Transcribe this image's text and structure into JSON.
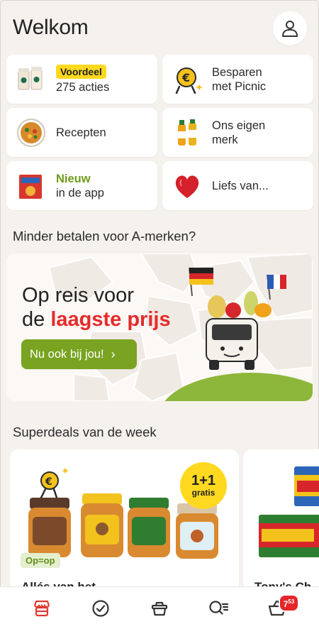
{
  "header": {
    "title": "Welkom"
  },
  "tiles": [
    {
      "badge": "Voordeel",
      "label": "275 acties"
    },
    {
      "label": "Besparen met Picnic"
    },
    {
      "label": "Recepten"
    },
    {
      "label": "Ons eigen merk"
    },
    {
      "accent": "Nieuw",
      "label": "in de app"
    },
    {
      "label": "Liefs van..."
    }
  ],
  "sections": {
    "brands_title": "Minder betalen voor A-merken?",
    "deals_title": "Superdeals van de week"
  },
  "banner": {
    "line1": "Op reis voor",
    "line2_prefix": "de",
    "line2_highlight": "laagste prijs",
    "cta": "Nu ook bij jou!",
    "cta_chevron": "›"
  },
  "deals": {
    "card1": {
      "promo_big": "1+1",
      "promo_small": "gratis",
      "label": "Op=op",
      "name": "Allés van het..."
    },
    "card2": {
      "name": "Tony's Ch..."
    }
  },
  "cart": {
    "badge_main": "7",
    "badge_sup": "53"
  },
  "colors": {
    "accent_green": "#79a321",
    "accent_red": "#e62a2a",
    "badge_yellow": "#ffd91f",
    "background": "#f5f2ee"
  },
  "icons": {
    "profile": "person-icon",
    "nav": [
      "store-icon",
      "checkmark-icon",
      "basket-icon",
      "search-list-icon",
      "cart-icon"
    ]
  }
}
